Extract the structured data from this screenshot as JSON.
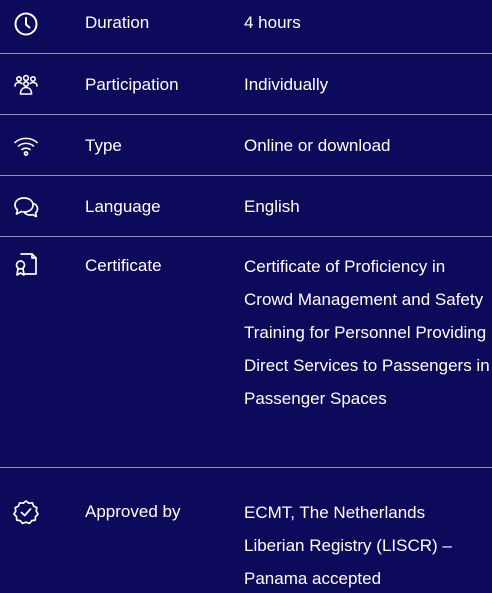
{
  "rows": [
    {
      "icon": "clock-icon",
      "label": "Duration",
      "value": "4 hours"
    },
    {
      "icon": "people-group-icon",
      "label": "Participation",
      "value": "Individually"
    },
    {
      "icon": "wifi-icon",
      "label": "Type",
      "value": "Online or download"
    },
    {
      "icon": "chat-bubbles-icon",
      "label": "Language",
      "value": "English"
    },
    {
      "icon": "certificate-icon",
      "label": "Certificate",
      "value": "Certificate of Proficiency in Crowd Management and Safety Training for Personnel Providing Direct Services to Passengers in Passenger Spaces"
    },
    {
      "icon": "approved-badge-icon",
      "label": "Approved by",
      "value": "ECMT, The Netherlands Liberian Registry (LISCR) – Panama accepted"
    }
  ],
  "colors": {
    "background": "#0d0a5c",
    "text": "#ffffff",
    "divider": "rgba(255,255,255,0.55)"
  }
}
